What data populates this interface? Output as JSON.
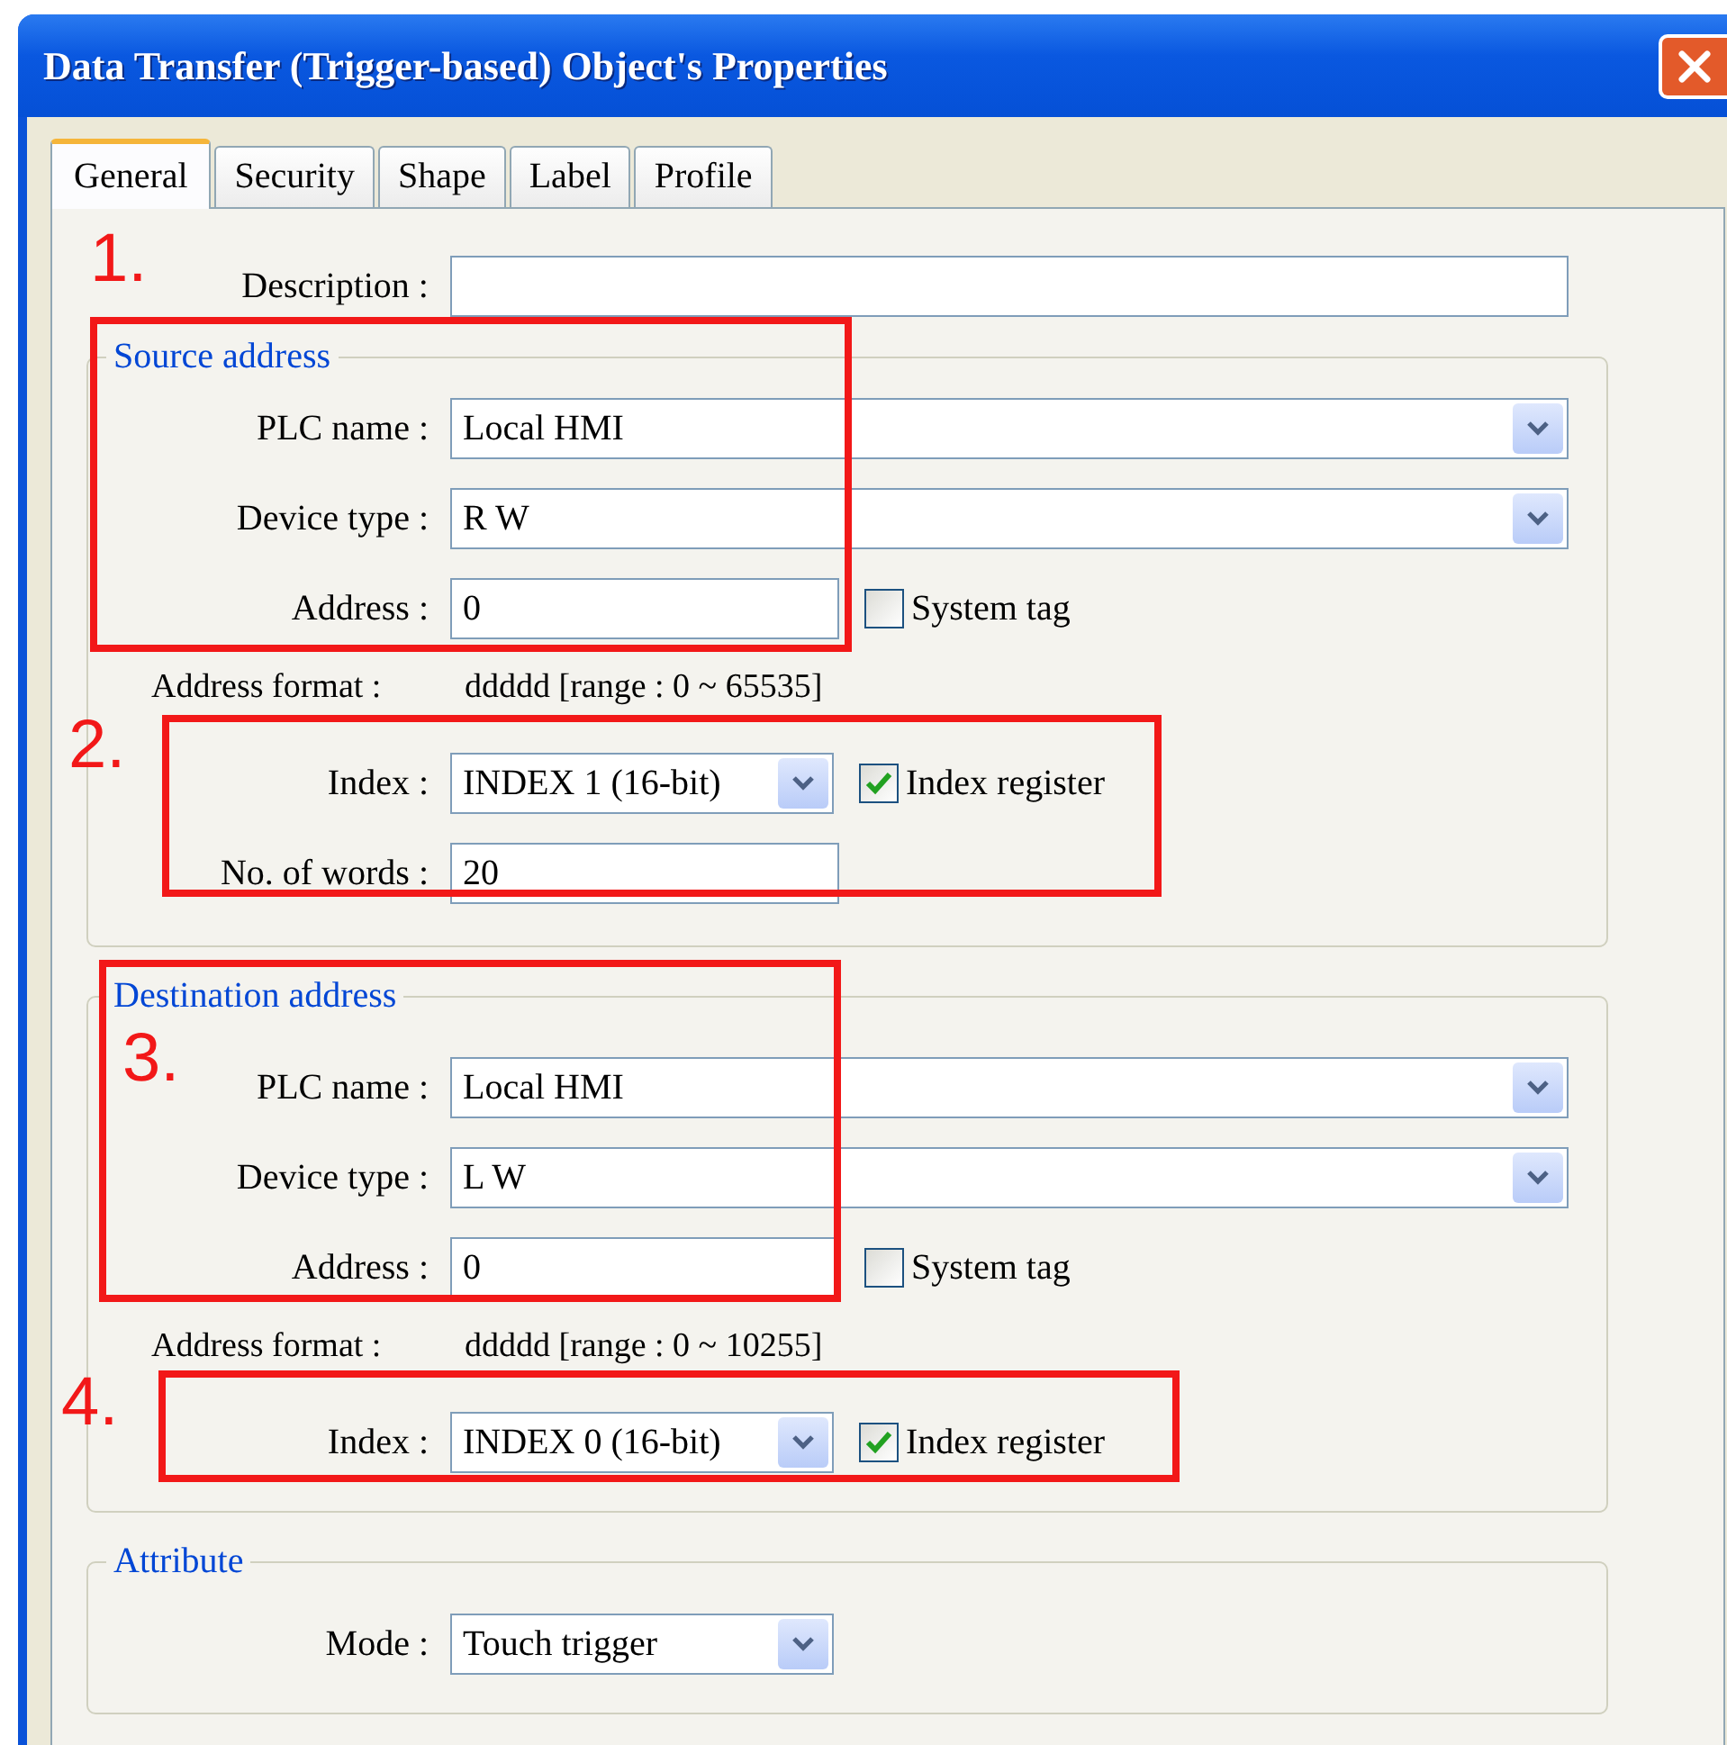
{
  "window": {
    "title": "Data Transfer (Trigger-based) Object's Properties"
  },
  "tabs": [
    {
      "label": "General",
      "selected": true
    },
    {
      "label": "Security",
      "selected": false
    },
    {
      "label": "Shape",
      "selected": false
    },
    {
      "label": "Label",
      "selected": false
    },
    {
      "label": "Profile",
      "selected": false
    }
  ],
  "description": {
    "label": "Description :"
  },
  "groups": [
    {
      "legend": "Source address",
      "rows": [
        {
          "kind": "select",
          "label": "PLC name :",
          "value": "Local HMI"
        },
        {
          "kind": "select",
          "label": "Device type :",
          "value": "R W"
        },
        {
          "kind": "input",
          "label": "Address :",
          "value": "0",
          "checkbox": {
            "label": "System tag",
            "checked": false
          }
        },
        {
          "kind": "info",
          "label": "Address format :",
          "value": "ddddd [range : 0 ~ 65535]"
        },
        {
          "kind": "small-select",
          "label": "Index :",
          "value": "INDEX 1 (16-bit)",
          "checkbox": {
            "label": "Index register",
            "checked": true
          }
        },
        {
          "kind": "input",
          "label": "No. of words :",
          "value": "20"
        }
      ]
    },
    {
      "legend": "Destination  address",
      "rows": [
        {
          "kind": "select",
          "label": "PLC name :",
          "value": "Local HMI"
        },
        {
          "kind": "select",
          "label": "Device type :",
          "value": "L W"
        },
        {
          "kind": "input",
          "label": "Address :",
          "value": "0",
          "checkbox": {
            "label": "System tag",
            "checked": false
          }
        },
        {
          "kind": "info",
          "label": "Address format :",
          "value": "ddddd [range : 0 ~ 10255]"
        },
        {
          "kind": "small-select",
          "label": "Index :",
          "value": "INDEX 0 (16-bit)",
          "checkbox": {
            "label": "Index register",
            "checked": true
          }
        }
      ]
    },
    {
      "legend": "Attribute",
      "rows": [
        {
          "kind": "small-select",
          "label": "Mode :",
          "value": "Touch trigger"
        }
      ]
    }
  ],
  "annotations": [
    {
      "number": "1."
    },
    {
      "number": "2."
    },
    {
      "number": "3."
    },
    {
      "number": "4."
    }
  ]
}
